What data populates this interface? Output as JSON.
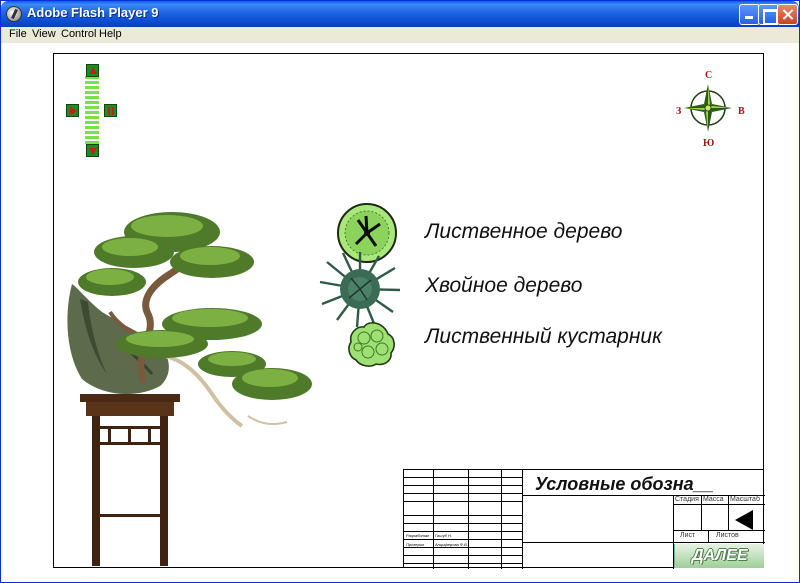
{
  "window": {
    "title": "Adobe Flash Player 9"
  },
  "menu": [
    "File",
    "View",
    "Control",
    "Help"
  ],
  "compass": {
    "north": "С",
    "east": "В",
    "west": "З",
    "south": "Ю"
  },
  "legend": [
    {
      "label": "Лиственное  дерево",
      "symbol": "deciduous-tree-symbol-icon"
    },
    {
      "label": "Хвойное дерево",
      "symbol": "conifer-tree-symbol-icon"
    },
    {
      "label": "Лиственный кустарник",
      "symbol": "shrub-symbol-icon"
    }
  ],
  "title_block": {
    "title": "Условные обозна__",
    "stage_header": "Стадия",
    "mass_header": "Масса",
    "scale_header": "Масштаб",
    "sheet_label": "Лист",
    "sheets_label": "Листов",
    "developed_label": "Разработал",
    "developed_name": "Гашуб Н.",
    "checked_label": "Проверил",
    "checked_name": "Анциферова Ф.В.",
    "next_label": "ДАЛЕЕ"
  },
  "colors": {
    "titlebar": "#0a5bf0",
    "legend_green": "#7ce04e",
    "conifer": "#2f5a46",
    "accent_red": "#b01010"
  }
}
